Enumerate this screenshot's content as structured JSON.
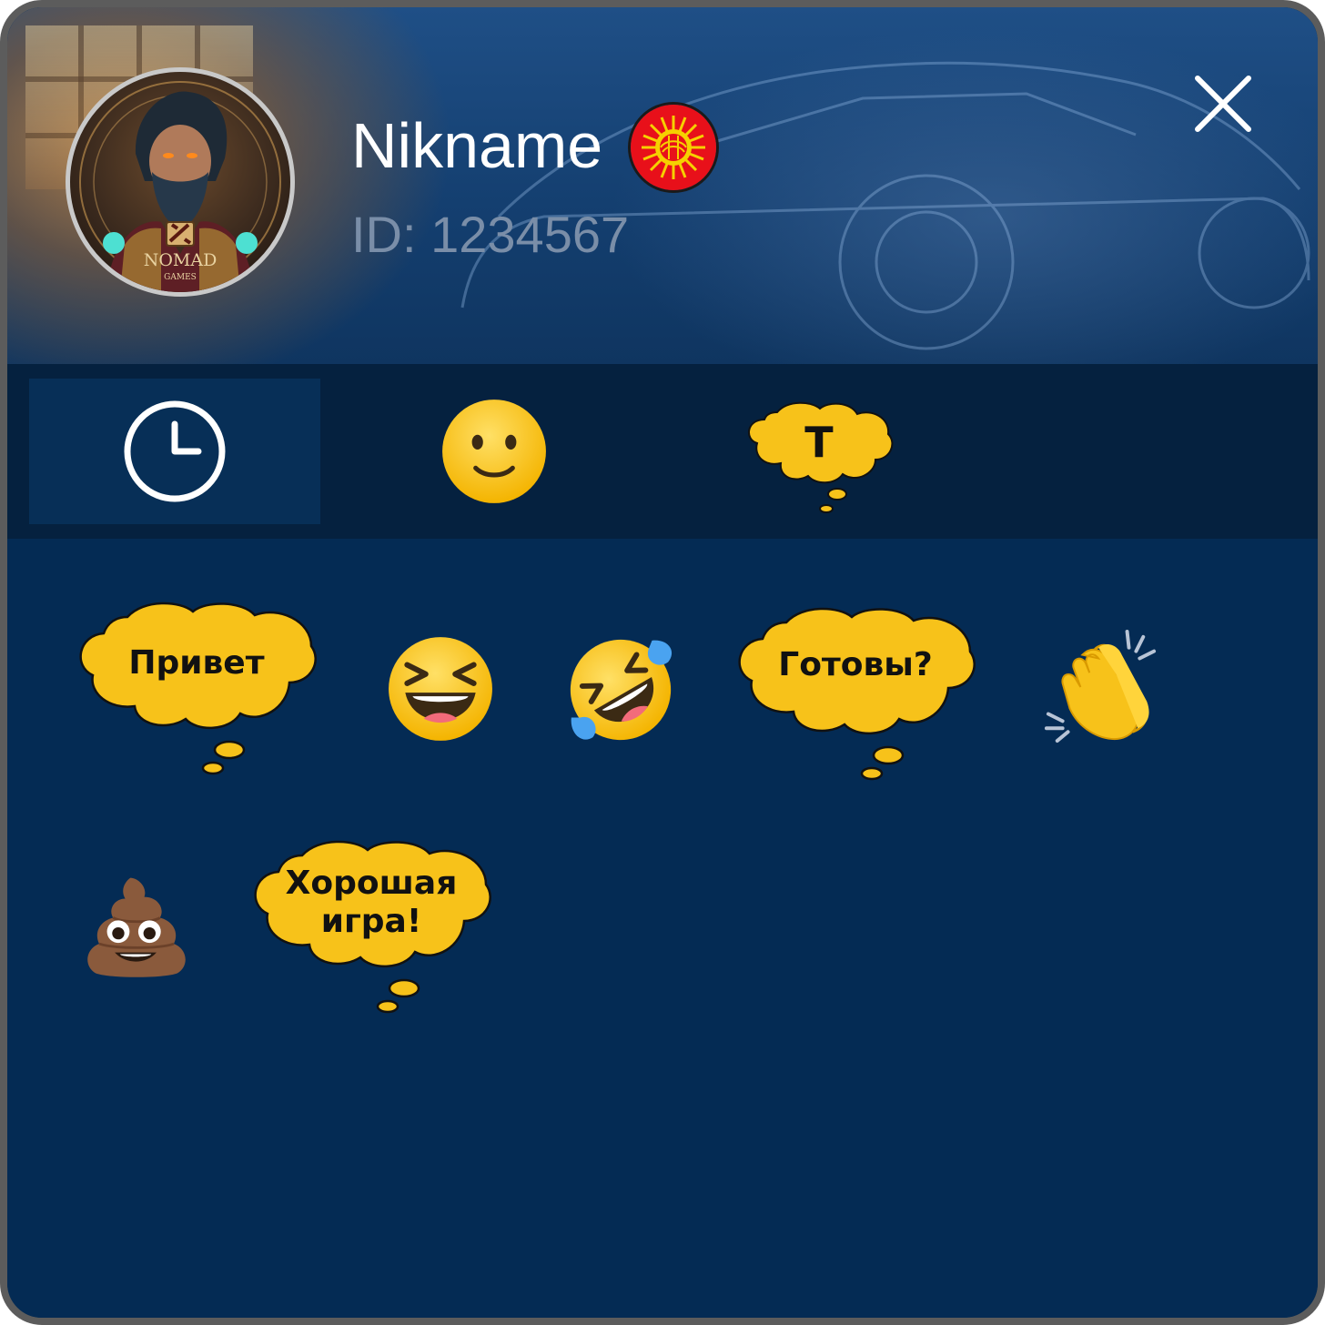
{
  "profile": {
    "nickname": "Nikname",
    "id_text": "ID: 1234567",
    "avatar_brand": "NOMAD",
    "avatar_brand_sub": "GAMES",
    "flag": "kyrgyzstan-flag-icon"
  },
  "header": {
    "close_icon": "close-icon"
  },
  "tabs": [
    {
      "icon": "clock-icon",
      "active": true
    },
    {
      "icon": "smiley-icon",
      "active": false
    },
    {
      "icon": "text-bubble-icon",
      "label": "T",
      "active": false
    }
  ],
  "reactions": [
    {
      "type": "phrase",
      "text": "Привет"
    },
    {
      "type": "emoji",
      "icon": "grinning-squinting-face-icon",
      "glyph": "😆"
    },
    {
      "type": "emoji",
      "icon": "rolling-on-floor-laughing-icon",
      "glyph": "🤣"
    },
    {
      "type": "phrase",
      "text": "Готовы?"
    },
    {
      "type": "emoji",
      "icon": "clapping-hands-icon",
      "glyph": "👏"
    },
    {
      "type": "emoji",
      "icon": "pile-of-poo-icon",
      "glyph": "💩"
    },
    {
      "type": "phrase",
      "text_line1": "Хорошая",
      "text_line2": "игра!"
    }
  ],
  "colors": {
    "panel_bg": "#042b54",
    "tabbar_bg": "#05213f",
    "tab_active_bg": "#072f57",
    "bubble_fill": "#f7c21a",
    "border": "#5c5c5c"
  }
}
